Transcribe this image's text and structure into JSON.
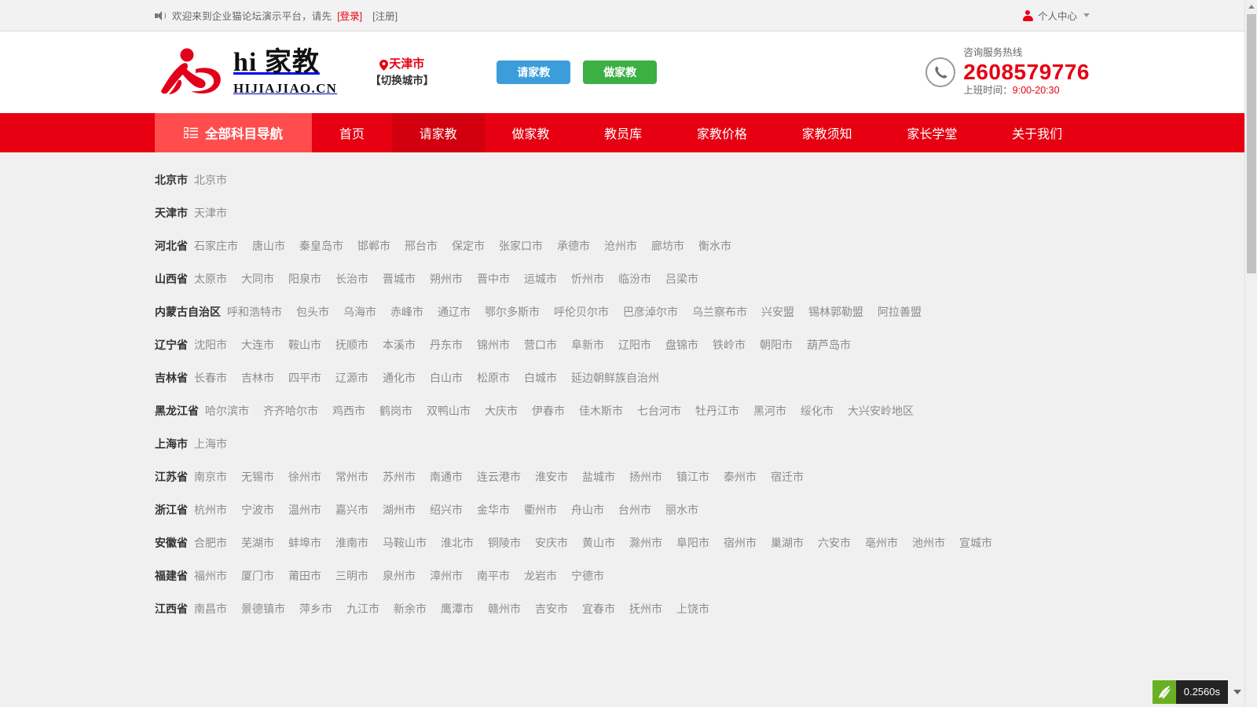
{
  "topbar": {
    "speaker_icon": "speaker-icon",
    "welcome": "欢迎来到企业猫论坛演示平台，请先",
    "login": "[登录]",
    "register": "[注册]",
    "user_icon": "person-icon",
    "user_center": "个人中心",
    "caret_icon": "chevron-down-icon"
  },
  "header": {
    "logo_title": "hi 家教",
    "logo_sub": "HIJIAJIAO.CN",
    "logo_icon": "running-figure-logo",
    "pin_icon": "location-pin-icon",
    "city_name": "天津市",
    "city_switch": "【切换城市】",
    "btn_request": "请家教",
    "btn_become": "做家教",
    "phone_icon": "telephone-icon",
    "phone_label": "咨询服务热线",
    "phone_number": "2608579776",
    "phone_hours_label": "上班时间：",
    "phone_hours_value": "9:00-20:30"
  },
  "nav": {
    "all_subjects_icon": "grid-list-icon",
    "all_subjects": "全部科目导航",
    "items": [
      {
        "label": "首页",
        "active": false
      },
      {
        "label": "请家教",
        "active": true
      },
      {
        "label": "做家教",
        "active": false
      },
      {
        "label": "教员库",
        "active": false
      },
      {
        "label": "家教价格",
        "active": false
      },
      {
        "label": "家教须知",
        "active": false
      },
      {
        "label": "家长学堂",
        "active": false
      },
      {
        "label": "关于我们",
        "active": false
      }
    ]
  },
  "colors": {
    "brand_red": "#e60012",
    "nav_light_red": "#ff4d4d",
    "nav_active_red": "#d2000f",
    "btn_blue": "#3c9ddb",
    "btn_green": "#3cb043",
    "page_bg": "#f0f0f0",
    "city_text": "#8c8c8c"
  },
  "regions": [
    {
      "province": "北京市",
      "cities": [
        "北京市"
      ]
    },
    {
      "province": "天津市",
      "cities": [
        "天津市"
      ]
    },
    {
      "province": "河北省",
      "cities": [
        "石家庄市",
        "唐山市",
        "秦皇岛市",
        "邯郸市",
        "邢台市",
        "保定市",
        "张家口市",
        "承德市",
        "沧州市",
        "廊坊市",
        "衡水市"
      ]
    },
    {
      "province": "山西省",
      "cities": [
        "太原市",
        "大同市",
        "阳泉市",
        "长治市",
        "晋城市",
        "朔州市",
        "晋中市",
        "运城市",
        "忻州市",
        "临汾市",
        "吕梁市"
      ]
    },
    {
      "province": "内蒙古自治区",
      "cities": [
        "呼和浩特市",
        "包头市",
        "乌海市",
        "赤峰市",
        "通辽市",
        "鄂尔多斯市",
        "呼伦贝尔市",
        "巴彦淖尔市",
        "乌兰察布市",
        "兴安盟",
        "锡林郭勒盟",
        "阿拉善盟"
      ]
    },
    {
      "province": "辽宁省",
      "cities": [
        "沈阳市",
        "大连市",
        "鞍山市",
        "抚顺市",
        "本溪市",
        "丹东市",
        "锦州市",
        "营口市",
        "阜新市",
        "辽阳市",
        "盘锦市",
        "铁岭市",
        "朝阳市",
        "葫芦岛市"
      ]
    },
    {
      "province": "吉林省",
      "cities": [
        "长春市",
        "吉林市",
        "四平市",
        "辽源市",
        "通化市",
        "白山市",
        "松原市",
        "白城市",
        "延边朝鲜族自治州"
      ]
    },
    {
      "province": "黑龙江省",
      "cities": [
        "哈尔滨市",
        "齐齐哈尔市",
        "鸡西市",
        "鹤岗市",
        "双鸭山市",
        "大庆市",
        "伊春市",
        "佳木斯市",
        "七台河市",
        "牡丹江市",
        "黑河市",
        "绥化市",
        "大兴安岭地区"
      ]
    },
    {
      "province": "上海市",
      "cities": [
        "上海市"
      ]
    },
    {
      "province": "江苏省",
      "cities": [
        "南京市",
        "无锡市",
        "徐州市",
        "常州市",
        "苏州市",
        "南通市",
        "连云港市",
        "淮安市",
        "盐城市",
        "扬州市",
        "镇江市",
        "泰州市",
        "宿迁市"
      ]
    },
    {
      "province": "浙江省",
      "cities": [
        "杭州市",
        "宁波市",
        "温州市",
        "嘉兴市",
        "湖州市",
        "绍兴市",
        "金华市",
        "衢州市",
        "舟山市",
        "台州市",
        "丽水市"
      ]
    },
    {
      "province": "安徽省",
      "cities": [
        "合肥市",
        "芜湖市",
        "蚌埠市",
        "淮南市",
        "马鞍山市",
        "淮北市",
        "铜陵市",
        "安庆市",
        "黄山市",
        "滁州市",
        "阜阳市",
        "宿州市",
        "巢湖市",
        "六安市",
        "亳州市",
        "池州市",
        "宣城市"
      ]
    },
    {
      "province": "福建省",
      "cities": [
        "福州市",
        "厦门市",
        "莆田市",
        "三明市",
        "泉州市",
        "漳州市",
        "南平市",
        "龙岩市",
        "宁德市"
      ]
    },
    {
      "province": "江西省",
      "cities": [
        "南昌市",
        "景德镇市",
        "萍乡市",
        "九江市",
        "新余市",
        "鹰潭市",
        "赣州市",
        "吉安市",
        "宜春市",
        "抚州市",
        "上饶市"
      ]
    }
  ],
  "debug": {
    "icon": "thinkphp-leaf-icon",
    "time": "0.2560s",
    "caret_icon": "chevron-down-icon"
  },
  "scrollbar": {
    "up_arrow_icon": "scroll-up-arrow-icon",
    "thumb": "scrollbar-thumb"
  }
}
